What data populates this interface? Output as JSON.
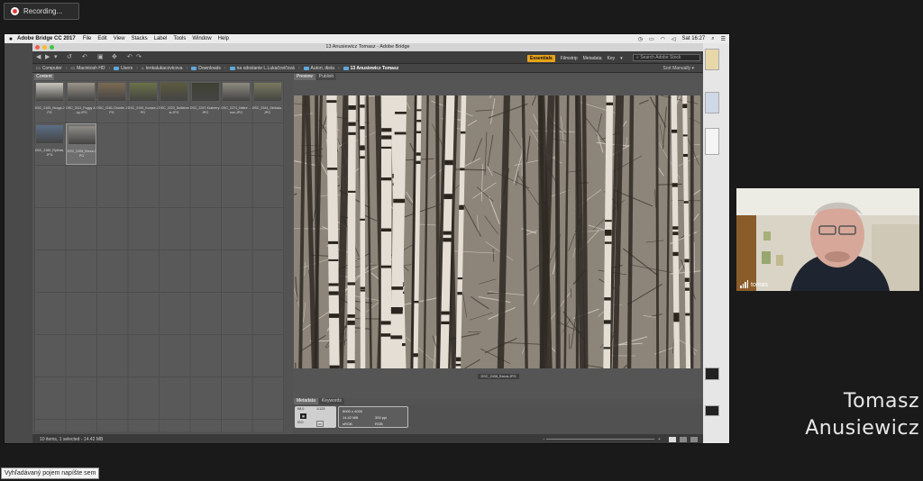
{
  "recording": {
    "label": "Recording..."
  },
  "menubar": {
    "app": "Adobe Bridge CC 2017",
    "items": [
      "File",
      "Edit",
      "View",
      "Stacks",
      "Label",
      "Tools",
      "Window",
      "Help"
    ],
    "clock": "Sat 16:27"
  },
  "window": {
    "title": "13 Anusiewicz Tomasz - Adobe Bridge"
  },
  "toolbar": {
    "workspaces": [
      "Essentials",
      "Filmstrip",
      "Metadata",
      "Key"
    ],
    "search_placeholder": "Search Adobe Stock"
  },
  "path": {
    "segments": [
      "Computer",
      "Macintosh HD",
      "Users",
      "lenkalukacovicova",
      "Downloads",
      "na odoslanie L.Lukačovičová",
      "Autori, diela",
      "13 Anusiewicz Tomasz"
    ],
    "sort": "Sort Manually"
  },
  "content": {
    "tab": "Content",
    "thumbnails": [
      {
        "name": "DSC_2183_Ncogo.JPG",
        "tone": "#c9c5bd"
      },
      {
        "name": "DSC_2111_Foggy & ...ky.JPG",
        "tone": "#9a948a"
      },
      {
        "name": "DSC_2181-Gruntie.JPG",
        "tone": "#7c6a52"
      },
      {
        "name": "DSC_2193_Koraze.JPG",
        "tone": "#6b7246"
      },
      {
        "name": "DSC_2223_Solitarnest.JPG",
        "tone": "#5c5a3e"
      },
      {
        "name": "DSC_2257-Kraberry.JPG",
        "tone": "#3e4232"
      },
      {
        "name": "DSC_2274_Neitre ...rum.JPG",
        "tone": "#8d8a7f"
      },
      {
        "name": "DSC_2344_Zimbalo.JPG",
        "tone": "#7a7a5e"
      },
      {
        "name": "DSC_2380_Rytimis.JPG",
        "tone": "#5a6e86"
      },
      {
        "name": "DSC_2408_Breza.JPG",
        "tone": "#8f8c87"
      }
    ],
    "selected_index": 9
  },
  "preview": {
    "tabs": [
      "Preview",
      "Publish"
    ],
    "caption": "DSC_2408_Breza.JPG"
  },
  "metadata": {
    "tabs": [
      "Metadata",
      "Keywords"
    ],
    "aperture": "f/8.0",
    "shutter": "1/125",
    "iso": "ISO",
    "dimensions": "6000 x 4000",
    "size": "14.42 MB",
    "ppi": "300 ppi",
    "profile": "sRGB",
    "color": "RGB"
  },
  "status": "10 items, 1 selected - 14.42 MB",
  "webcam": {
    "name": "tomas"
  },
  "speaker": {
    "name_line1": "Tomasz",
    "name_line2": "Anusiewicz"
  },
  "tooltip": "Vyhľadávaný pojem napíšte sem"
}
